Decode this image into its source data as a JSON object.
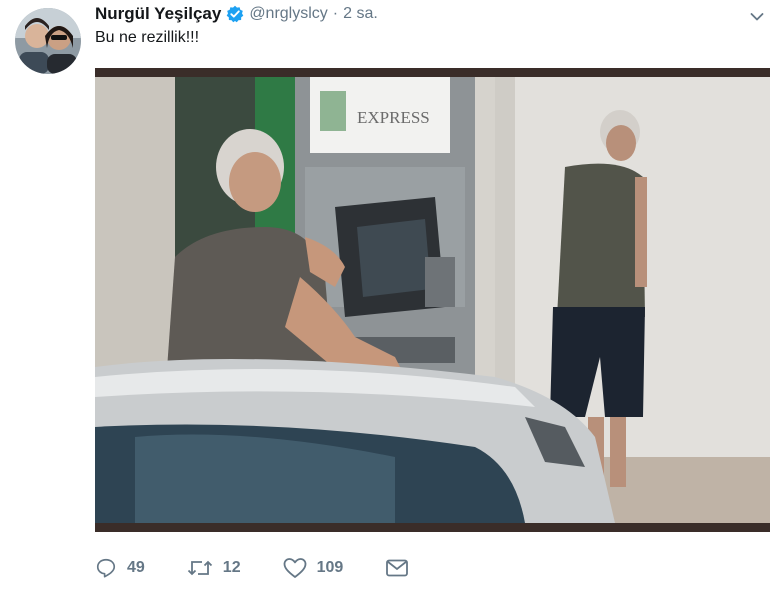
{
  "tweet": {
    "display_name": "Nurgül Yeşilçay",
    "handle": "@nrglyslcy",
    "separator": "·",
    "time": "2 sa.",
    "text": "Bu ne rezillik!!!",
    "verified": true,
    "media_sign_text": "EXPRESS"
  },
  "actions": {
    "reply_count": "49",
    "retweet_count": "12",
    "like_count": "109"
  },
  "colors": {
    "name": "#14171a",
    "meta": "#657786",
    "verified": "#1da1f2",
    "media_frame": "#3a2d29"
  },
  "icons": [
    "verified-icon",
    "caret-down-icon",
    "reply-icon",
    "retweet-icon",
    "like-icon",
    "direct-message-icon"
  ]
}
